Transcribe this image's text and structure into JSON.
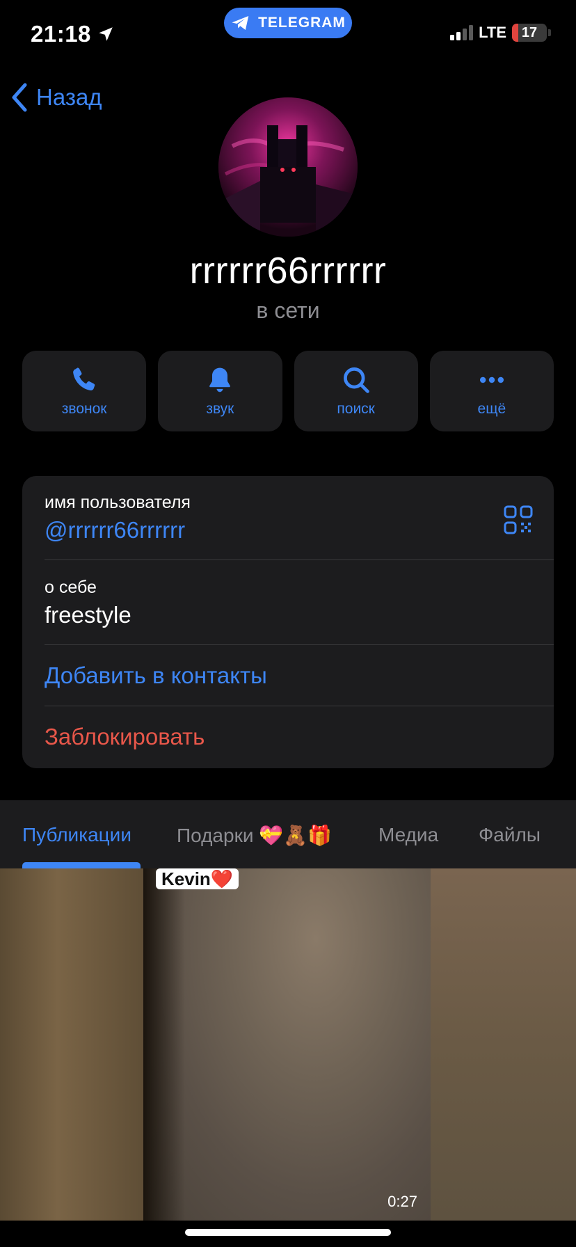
{
  "status_bar": {
    "time": "21:18",
    "app_pill": "TELEGRAM",
    "network": "LTE",
    "battery": "17"
  },
  "nav": {
    "back_label": "Назад"
  },
  "profile": {
    "name": "rrrrrr66rrrrrr",
    "status": "в сети"
  },
  "actions": [
    {
      "label": "звонок",
      "icon": "phone-icon"
    },
    {
      "label": "звук",
      "icon": "bell-icon"
    },
    {
      "label": "поиск",
      "icon": "search-icon"
    },
    {
      "label": "ещё",
      "icon": "more-icon"
    }
  ],
  "info": {
    "username_caption": "имя пользователя",
    "username": "@rrrrrr66rrrrrr",
    "bio_caption": "о себе",
    "bio": "freestyle",
    "add_contact": "Добавить в контакты",
    "block": "Заблокировать"
  },
  "tabs": [
    {
      "label": "Публикации",
      "active": true
    },
    {
      "label": "Подарки 💝🧸🎁",
      "active": false
    },
    {
      "label": "Медиа",
      "active": false
    },
    {
      "label": "Файлы",
      "active": false
    }
  ],
  "media": {
    "sticker_text": "Kevin❤️",
    "video_duration": "0:27"
  },
  "colors": {
    "accent": "#3e86f5",
    "danger": "#e8574a",
    "card": "#1c1c1e",
    "background": "#000000"
  }
}
